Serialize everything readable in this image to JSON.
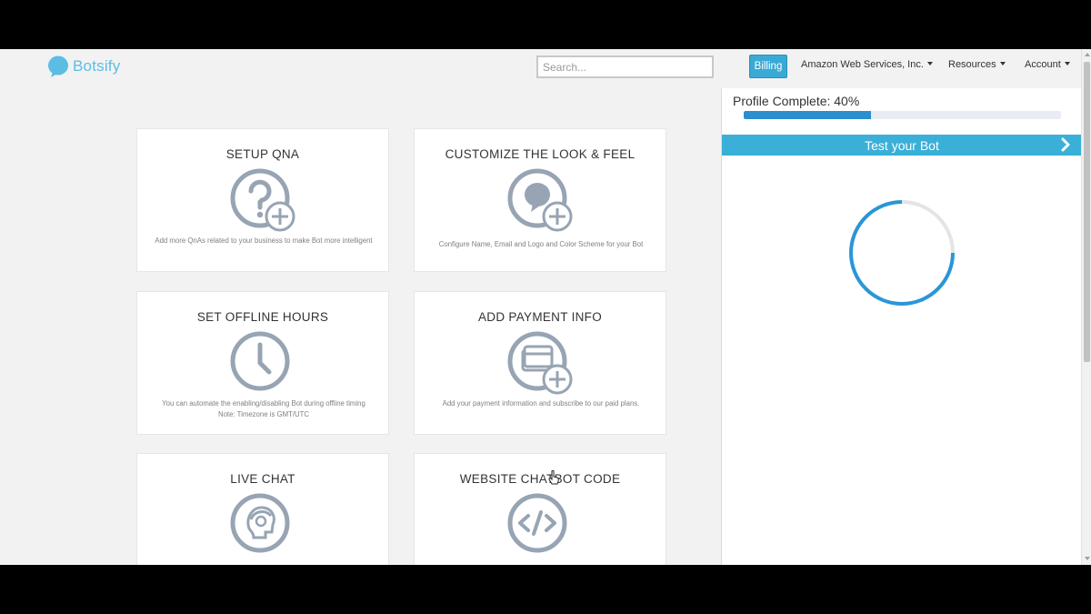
{
  "brand": {
    "name": "Botsify",
    "color": "#5bbde4"
  },
  "header": {
    "search_placeholder": "Search...",
    "billing_label": "Billing",
    "org_label": "Amazon Web Services, Inc.",
    "resources_label": "Resources",
    "account_label": "Account"
  },
  "profile": {
    "label": "Profile Complete: 40%",
    "percent": 40
  },
  "test_bot": {
    "label": "Test your Bot"
  },
  "cards": [
    {
      "title": "SETUP QNA",
      "description": "Add more QnAs related to your business to make Bot more intelligent",
      "icon": "question-add-icon"
    },
    {
      "title": "CUSTOMIZE THE LOOK & FEEL",
      "description": "Configure Name, Email and Logo and Color Scheme for your Bot",
      "icon": "chat-bubble-add-icon"
    },
    {
      "title": "SET OFFLINE HOURS",
      "description": "You can automate the enabling/disabling Bot during offline timing",
      "note": "Note: Timezone is GMT/UTC",
      "icon": "clock-icon"
    },
    {
      "title": "ADD PAYMENT INFO",
      "description": "Add your payment information and subscribe to our paid plans.",
      "icon": "card-add-icon"
    },
    {
      "title": "LIVE CHAT",
      "description": "",
      "icon": "headset-agent-icon"
    },
    {
      "title": "WEBSITE CHATBOT CODE",
      "description": "",
      "icon": "code-icon"
    }
  ],
  "colors": {
    "accent": "#3aa9d6",
    "progress": "#2a8fcc",
    "icon_gray": "#97a4b3",
    "background": "#f2f2f2"
  }
}
